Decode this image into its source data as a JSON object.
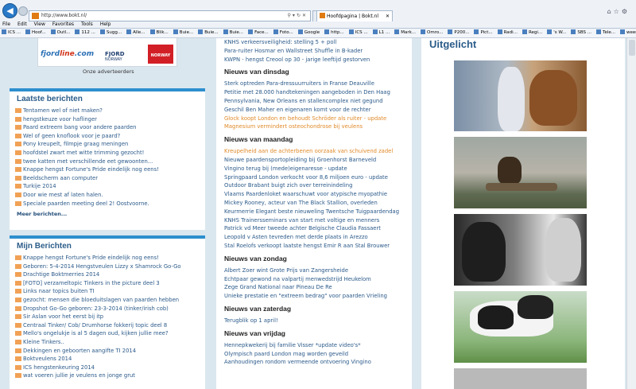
{
  "browser": {
    "url": "http://www.bokt.nl/",
    "tab_title": "Hoofdpagina | Bokt.nl",
    "menu": [
      "File",
      "Edit",
      "View",
      "Favorites",
      "Tools",
      "Help"
    ],
    "favorites": [
      "ICS ...",
      "Hoof...",
      "Outl...",
      "112 ...",
      "Sugg...",
      "Alle...",
      "Blik...",
      "Buie...",
      "Buie...",
      "Buie...",
      "Face...",
      "Foto...",
      "Google",
      "http...",
      "ICS ...",
      "L1 ...",
      "Mark...",
      "Omro...",
      "P200...",
      "Pict...",
      "Radi...",
      "Regi...",
      "'s W...",
      "SBS ...",
      "Tele...",
      "weer..."
    ]
  },
  "left": {
    "advertiser_caption": "Onze adverteerders",
    "ads": {
      "fjordline_a": "fjord",
      "fjordline_b": "line",
      "fjordline_c": ".com",
      "fjord_norway": "FJORD",
      "fjord_norway_sub": "NORWAY",
      "norway": "NORWAY"
    },
    "laatste": {
      "title": "Laatste berichten",
      "items": [
        "Tentamen wel of niet maken?",
        "hengstkeuze voor haflinger",
        "Paard extreem bang voor andere paarden",
        "Wel of geen knoflook voor je paard?",
        "Pony kreupelt, filmpje graag meningen",
        "hoofdstel zwart met witte trimming gezocht!",
        "twee katten met verschillende eet gewoonten...",
        "Knappe hengst Fortune's Pride eindelijk nog eens!",
        "Beeldscherm aan computer",
        "Turkije 2014",
        "Door wie mest af laten halen.",
        "Speciale paarden meeting deel 2! Oostvoorne."
      ],
      "more": "Meer berichten..."
    },
    "mijn": {
      "title": "Mijn Berichten",
      "items": [
        "Knappe hengst Fortune's Pride eindelijk nog eens!",
        "Geboren: 5-4-2014 Hengstveulen Lizzy x Shamrock Go-Go",
        "Drachtige Boktmerries 2014",
        "[FOTO] verzameltopic Tinkers in the picture deel 3",
        "Links naar topics buiten TI",
        "gezocht: mensen die bloeduitslagen van paarden hebben",
        "Dropshot Go-Go geboren: 23-3-2014 (tinker/irish cob)",
        "Sir Aslan voor het eerst bij itp",
        "Centraal Tinker/ Cob/ Drumhorse fokkerij topic deel 8",
        "Mello's ongelukje is al 5 dagen oud, kijken jullie mee?",
        "Kleine Tinkers..",
        "Dekkingen en geboorten aangifte TI 2014",
        "Boktveulens 2014",
        "ICS hengstenkeuring 2014",
        "wat voeren jullie je veulens en jonge grut"
      ]
    }
  },
  "news": {
    "top": [
      "KNHS verkeersveiligheid: stelling 5 + poll",
      "Para-ruiter Hosmar en Wallstreet Shuffle in B-kader",
      "KWPN - hengst Creool op 30 - jarige leeftijd gestorven"
    ],
    "dinsdag": {
      "title": "Nieuws van dinsdag",
      "items": [
        "Sterk optreden Para-dressuurruiters in Franse Deauville",
        "Petitie met 28.000 handtekeningen aangeboden in Den Haag",
        "Pennsylvania, New Orleans en stallencomplex niet gegund",
        "Geschil Ben Maher en eigenaren komt voor de rechter",
        "Glock koopt London en behoudt Schröder als ruiter - update",
        "Magnesium vermindert osteochondrose bij veulens"
      ]
    },
    "maandag": {
      "title": "Nieuws van maandag",
      "items": [
        "Kreupelheid aan de achterbenen oorzaak van schuivend zadel",
        "Nieuwe paardensportopleiding bij Groenhorst Barneveld",
        "Vingino terug bij (mede)eigenaresse - update",
        "Springpaard London verkocht voor 8,6 miljoen euro - update",
        "Outdoor Brabant buigt zich over terreinindeling",
        "Vlaams Paardenloket waarschuwt voor atypische myopathie",
        "Mickey Rooney, acteur van The Black Stallion, overleden",
        "Keurmerrie Elegant beste nieuweling Twentsche Tuigpaardendag",
        "KNHS Trainersseminars van start met voltige en menners",
        "Patrick vd Meer tweede achter Belgische Claudia Fassaert",
        "Leopold v Asten tevreden met derde plaats in Arezzo",
        "Stal Roelofs verkoopt laatste hengst Emir R aan Stal Brouwer"
      ]
    },
    "zondag": {
      "title": "Nieuws van zondag",
      "items": [
        "Albert Zoer wint Grote Prijs van Zangersheide",
        "Echtpaar gewond na valpartij menwedstrijd Heukelom",
        "Zege Grand National naar Pineau De Re",
        "Unieke prestatie en \"extreem bedrag\" voor paarden Vrieling"
      ]
    },
    "zaterdag": {
      "title": "Nieuws van zaterdag",
      "items": [
        "Terugblik op 1 april!"
      ]
    },
    "vrijdag": {
      "title": "Nieuws van vrijdag",
      "items": [
        "Hennepkwekerij bij familie Visser *update video's*",
        "Olympisch paard London mag worden geveild",
        "Aanhoudingen rondom vermeende ontvoering Vingino"
      ]
    }
  },
  "uitgelicht": {
    "title": "Uitgelicht"
  },
  "colors": {
    "link": "#2b5a8a",
    "visited": "#e08a2a",
    "accent": "#2d8fce",
    "bullet": "#f1a155"
  }
}
